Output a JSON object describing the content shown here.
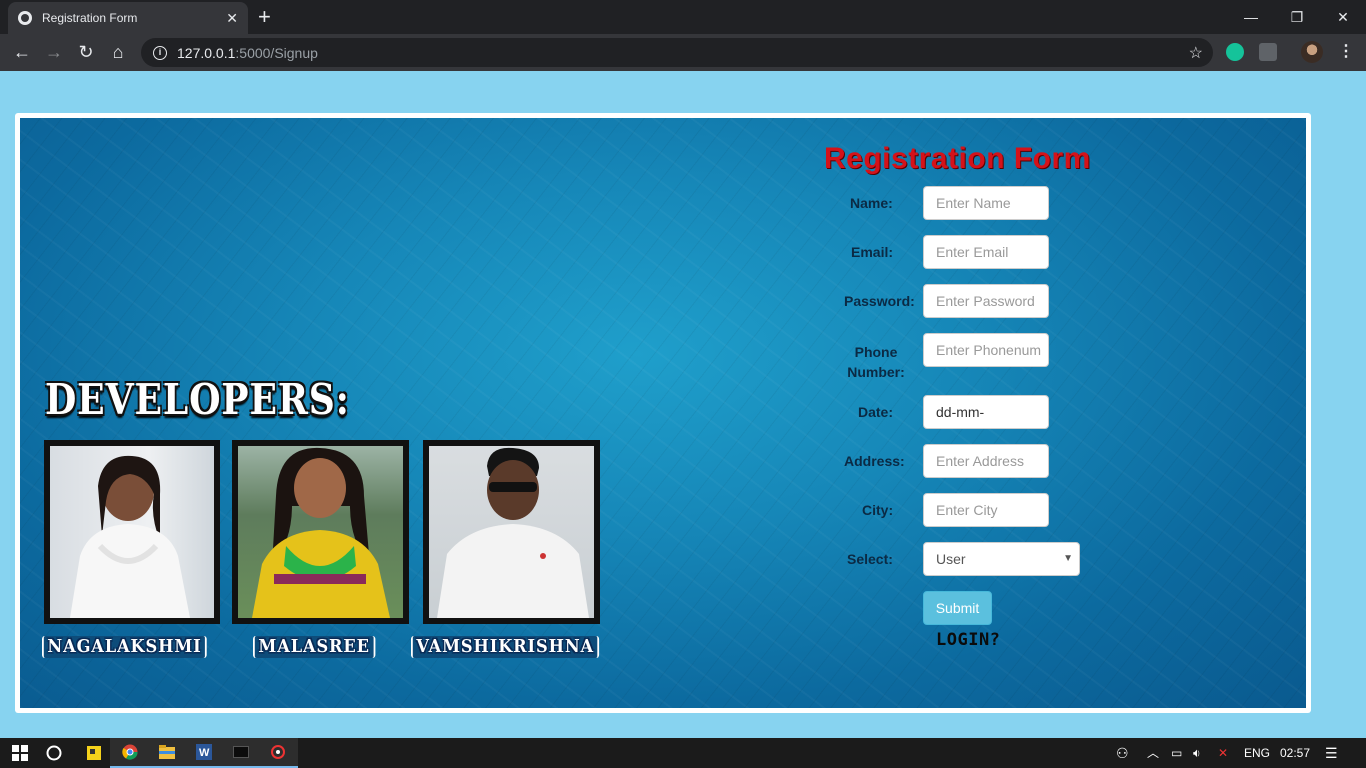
{
  "browser": {
    "tab_title": "Registration Form",
    "tab_close": "✕",
    "new_tab": "+",
    "url_host": "127.0.0.1",
    "url_path": ":5000/Signup",
    "window_controls": [
      "—",
      "❐",
      "✕"
    ]
  },
  "developers": {
    "heading": "DEVELOPERS:",
    "names": [
      "NAGALAKSHMI",
      "MALASREE",
      "VAMSHIKRISHNA"
    ]
  },
  "form": {
    "title": "Registration Form",
    "fields": [
      {
        "label": "Name:",
        "placeholder": "Enter Name"
      },
      {
        "label": "Email:",
        "placeholder": "Enter Email"
      },
      {
        "label": "Password:",
        "placeholder": "Enter Password"
      },
      {
        "label": "Phone Number:",
        "placeholder": "Enter Phonenum"
      },
      {
        "label": "Date:",
        "value": "dd-mm-"
      },
      {
        "label": "Address:",
        "placeholder": "Enter Address"
      },
      {
        "label": "City:",
        "placeholder": "Enter City"
      }
    ],
    "select_label": "Select:",
    "select_value": "User",
    "submit_label": "Submit",
    "login_link": "LOGIN?"
  },
  "taskbar": {
    "language": "ENG",
    "time": "02:57"
  },
  "colors": {
    "page_bg": "#87d3f0",
    "title_red": "#d4121a",
    "submit_blue": "#5bc0de"
  }
}
